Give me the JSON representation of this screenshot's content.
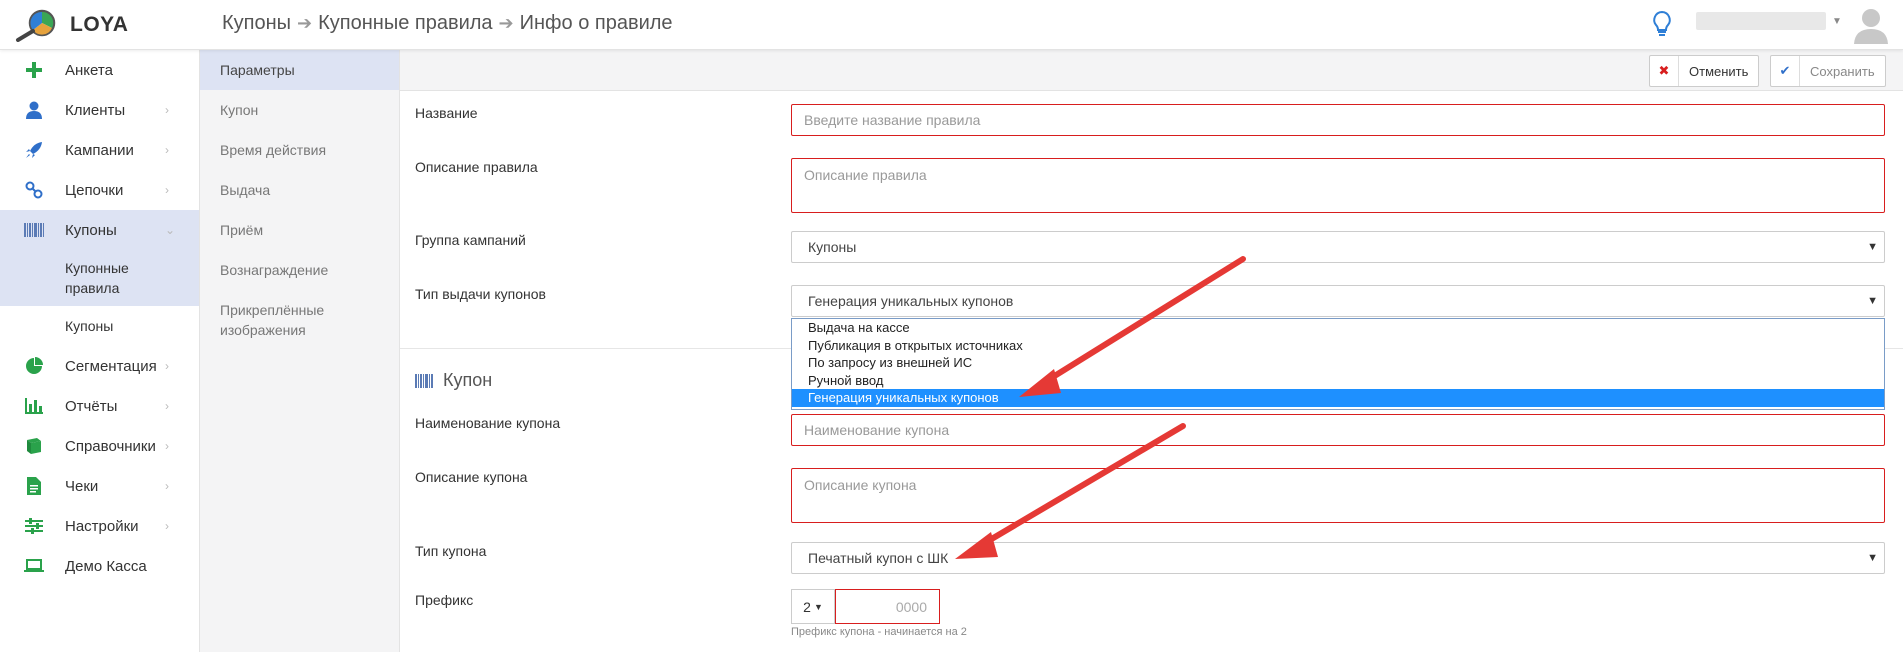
{
  "app": {
    "name": "LOYA"
  },
  "breadcrumb": [
    "Купоны",
    "Купонные правила",
    "Инфо о правиле"
  ],
  "sidebar": {
    "items": [
      {
        "label": "Анкета",
        "icon": "plus-icon"
      },
      {
        "label": "Клиенты",
        "icon": "user-icon"
      },
      {
        "label": "Кампании",
        "icon": "rocket-icon"
      },
      {
        "label": "Цепочки",
        "icon": "chain-icon"
      },
      {
        "label": "Купоны",
        "icon": "barcode-icon"
      },
      {
        "label": "Сегментация",
        "icon": "pie-chart-icon"
      },
      {
        "label": "Отчёты",
        "icon": "bar-chart-icon"
      },
      {
        "label": "Справочники",
        "icon": "book-icon"
      },
      {
        "label": "Чеки",
        "icon": "receipt-icon"
      },
      {
        "label": "Настройки",
        "icon": "sliders-icon"
      },
      {
        "label": "Демо Касса",
        "icon": "laptop-icon"
      }
    ],
    "sub_items": [
      "Купонные правила",
      "Купоны"
    ]
  },
  "subnav": {
    "items": [
      "Параметры",
      "Купон",
      "Время действия",
      "Выдача",
      "Приём",
      "Вознаграждение",
      "Прикреплённые изображения"
    ]
  },
  "toolbar": {
    "cancel_label": "Отменить",
    "save_label": "Сохранить"
  },
  "form": {
    "name_label": "Название",
    "name_placeholder": "Введите название правила",
    "description_label": "Описание правила",
    "description_placeholder": "Описание правила",
    "group_label": "Группа кампаний",
    "group_value": "Купоны",
    "issue_type_label": "Тип выдачи купонов",
    "issue_type_value": "Генерация уникальных купонов",
    "issue_type_options": [
      "Выдача на кассе",
      "Публикация в открытых источниках",
      "По запросу из внешней ИС",
      "Ручной ввод",
      "Генерация уникальных купонов"
    ],
    "coupon_section_title": "Купон",
    "coupon_name_label": "Наименование купона",
    "coupon_name_placeholder": "Наименование купона",
    "coupon_description_label": "Описание купона",
    "coupon_description_placeholder": "Описание купона",
    "coupon_type_label": "Тип купона",
    "coupon_type_value": "Печатный купон с ШК",
    "prefix_label": "Префикс",
    "prefix_select_value": "2",
    "prefix_placeholder": "0000",
    "prefix_hint": "Префикс купона - начинается на 2"
  },
  "colors": {
    "accent": "#dde3f3",
    "error_border": "#d81e1e",
    "selected_option": "#1e90ff",
    "arrow": "#e53935",
    "green_icon": "#2aa24b"
  }
}
